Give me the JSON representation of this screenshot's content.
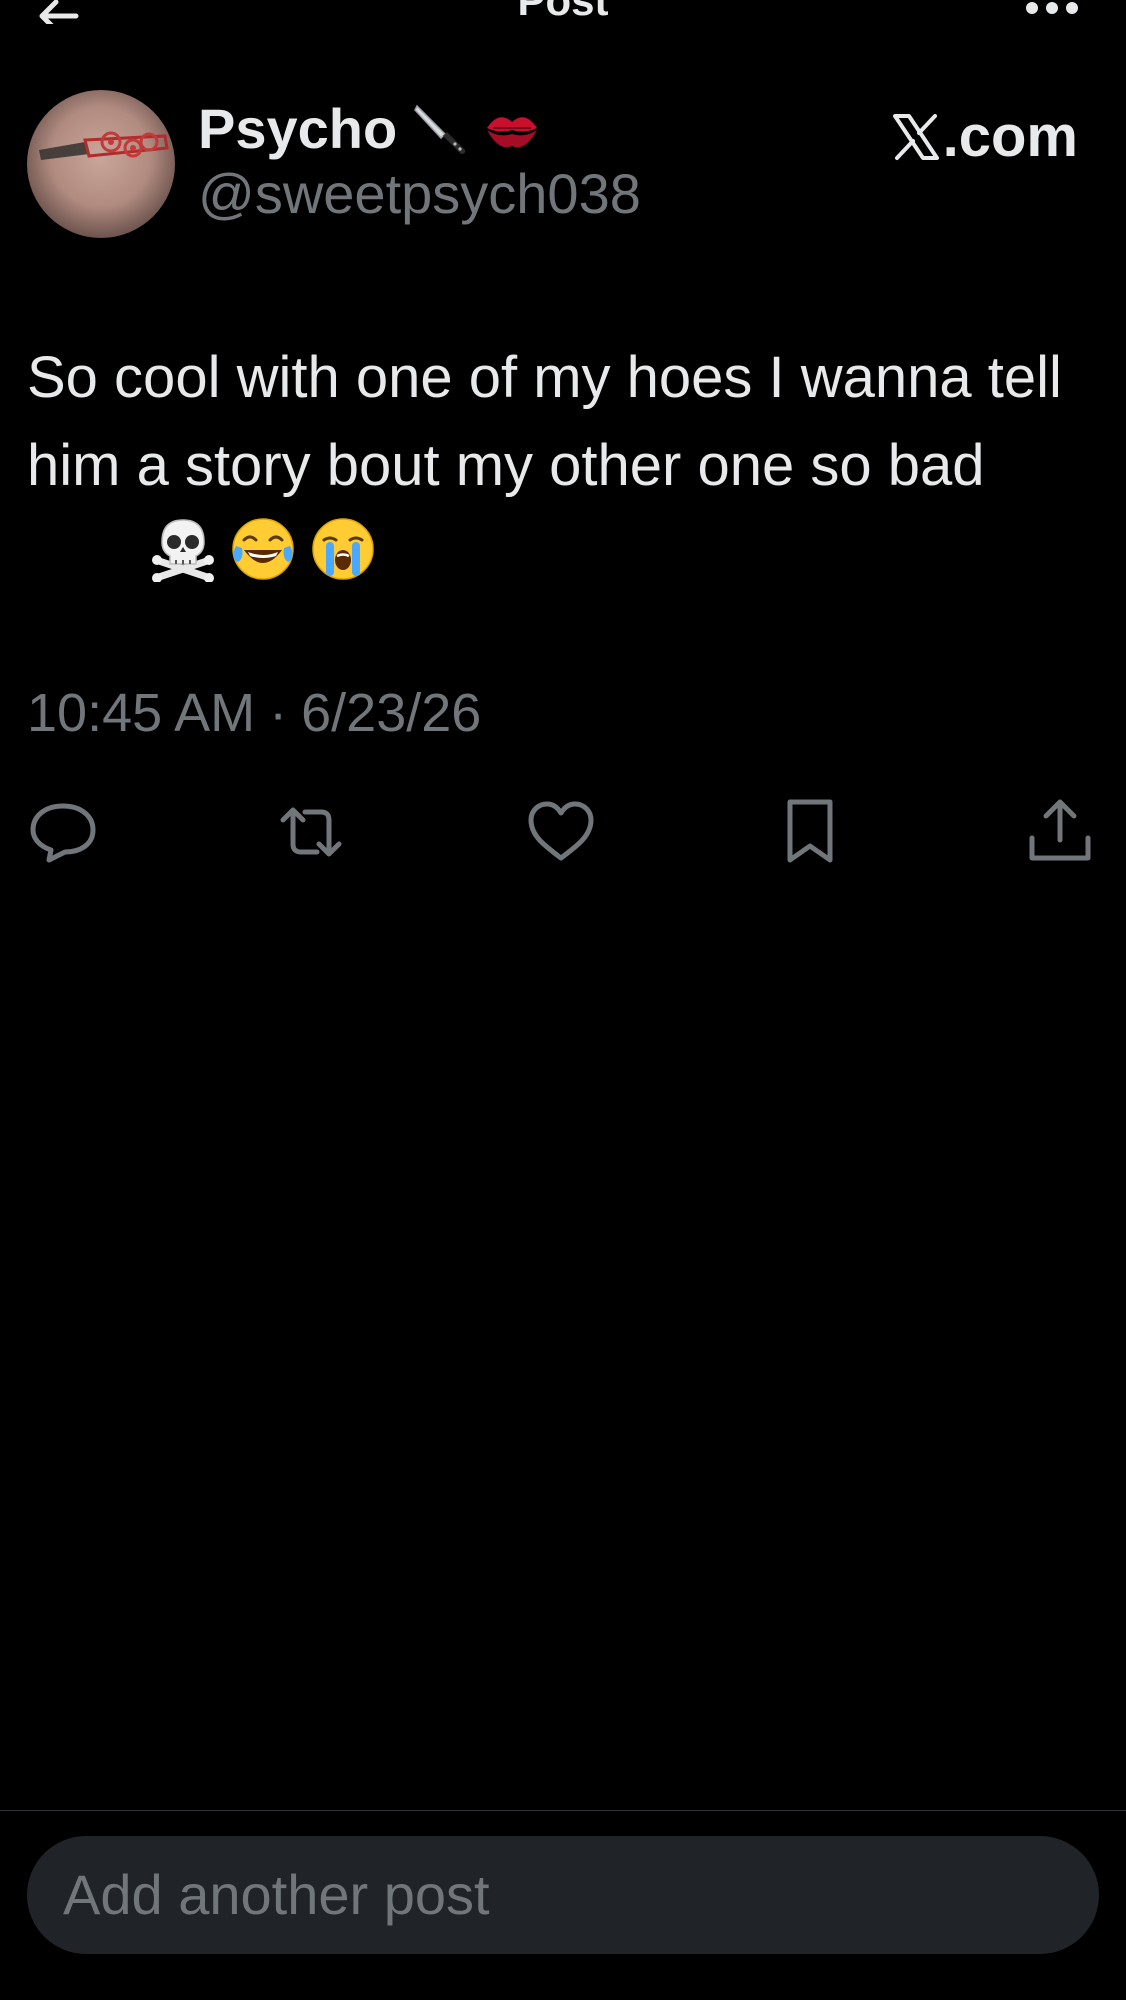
{
  "header": {
    "title": "Post",
    "back_icon": "arrow-left-icon",
    "more_icon": "more-icon"
  },
  "author": {
    "name": "Psycho",
    "name_emojis": [
      "knife-emoji",
      "kiss-mark-emoji"
    ],
    "handle": "@sweetpsych038",
    "avatar": "avatar-tattoo-photo"
  },
  "watermark": {
    "label": ".com",
    "logo": "x-logo-icon"
  },
  "post": {
    "text": "So cool with one of my hoes I wanna tell him a story bout my other one so bad",
    "emojis": [
      "skull-and-crossbones-emoji",
      "face-with-tears-of-joy-emoji",
      "loudly-crying-face-emoji"
    ],
    "time": "10:45 AM",
    "separator": "·",
    "date": "6/23/26"
  },
  "actions": [
    {
      "name": "reply",
      "icon": "reply-icon"
    },
    {
      "name": "repost",
      "icon": "repost-icon"
    },
    {
      "name": "like",
      "icon": "heart-icon"
    },
    {
      "name": "bookmark",
      "icon": "bookmark-icon"
    },
    {
      "name": "share",
      "icon": "share-icon"
    }
  ],
  "composer": {
    "placeholder": "Add another post"
  },
  "colors": {
    "background": "#000000",
    "primary_text": "#e7e9ea",
    "secondary_text": "#71767b",
    "composer_bg": "#202327"
  }
}
